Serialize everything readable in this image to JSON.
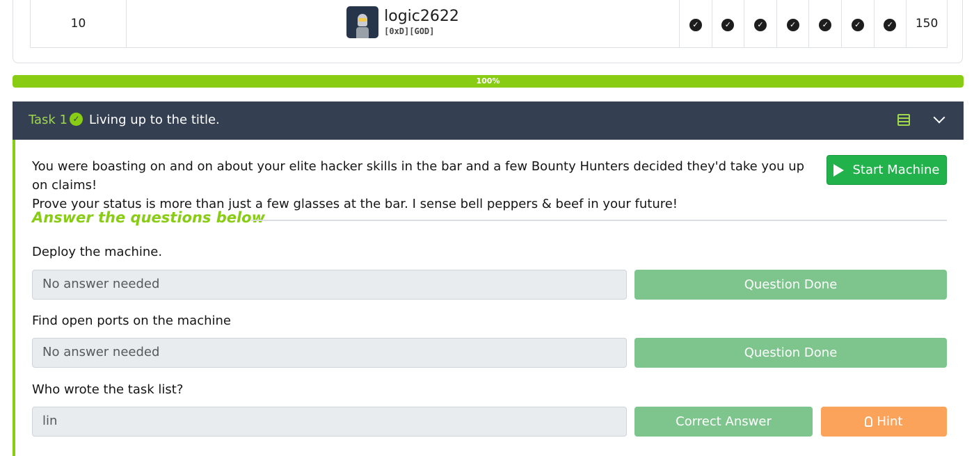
{
  "leaderboard": {
    "rank": "10",
    "username": "logic2622",
    "usertag": "[0xD][GOD]",
    "checks": [
      "✓",
      "✓",
      "✓",
      "✓",
      "✓",
      "✓",
      "✓"
    ],
    "points": "150"
  },
  "progress": {
    "value": 100,
    "label": "100%",
    "color": "#88cc14"
  },
  "task": {
    "number": "Task 1",
    "title": "Living up to the title.",
    "description_line1": "You were boasting on and on about your elite hacker skills in the bar and a few Bounty Hunters decided they'd take you up on claims!",
    "description_line2": "Prove your status is more than just a few glasses at the bar. I sense bell peppers & beef in your future!",
    "start_button": "Start Machine",
    "section_heading": "Answer the questions below",
    "questions": [
      {
        "label": "Deploy the machine.",
        "value": "No answer needed",
        "button": "Question Done"
      },
      {
        "label": "Find open ports on the machine",
        "value": "No answer needed",
        "button": "Question Done"
      },
      {
        "label": "Who wrote the task list?",
        "value": "lin",
        "button": "Correct Answer",
        "hint": "Hint"
      }
    ]
  },
  "colors": {
    "accent": "#88cc14",
    "header_bg": "#343f52",
    "start_green": "#21b24b",
    "done_green": "#7dc58c",
    "hint_orange": "#fca35b"
  }
}
